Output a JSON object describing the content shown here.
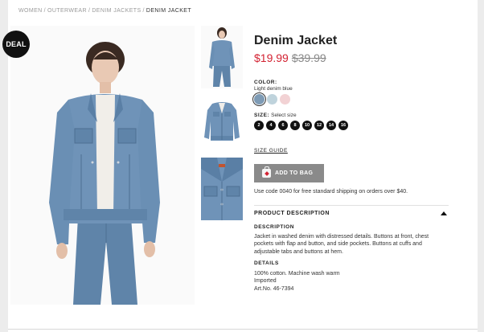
{
  "breadcrumb": {
    "items": [
      "WOMEN",
      "OUTERWEAR",
      "DENIM JACKETS"
    ],
    "current": "DENIM JACKET",
    "separator": "/"
  },
  "badge": {
    "label": "DEAL"
  },
  "product": {
    "title": "Denim Jacket",
    "price_now": "$19.99",
    "price_was": "$39.99"
  },
  "color": {
    "label": "COLOR:",
    "value": "Light denim blue",
    "swatches": [
      {
        "name": "light-denim-blue",
        "hex": "#7e9bb5",
        "selected": true
      },
      {
        "name": "pale-blue",
        "hex": "#bfd3dc",
        "selected": false
      },
      {
        "name": "pale-pink",
        "hex": "#f2d2d4",
        "selected": false
      }
    ]
  },
  "size": {
    "label": "SIZE:",
    "hint": "Select size",
    "options": [
      "2",
      "4",
      "6",
      "8",
      "10",
      "12",
      "14",
      "16"
    ]
  },
  "size_guide": "SIZE GUIDE",
  "add_to_bag": "ADD TO BAG",
  "promo": "Use code 0040 for free standard shipping on orders over $40.",
  "product_description": {
    "header": "PRODUCT DESCRIPTION",
    "description_title": "DESCRIPTION",
    "description_lines": [
      "Jacket in washed denim with distressed details. Buttons at front, chest",
      "pockets with flap and button, and side pockets. Buttons at cuffs and",
      "adjustable tabs and buttons at hem."
    ],
    "details_title": "DETAILS",
    "details_lines": [
      "100% cotton. Machine wash warm",
      "Imported",
      "Art.No. 46-7394"
    ]
  },
  "colors": {
    "price_sale": "#d32232",
    "button_bg": "#8a8a8a",
    "denim": "#6f93b8"
  }
}
